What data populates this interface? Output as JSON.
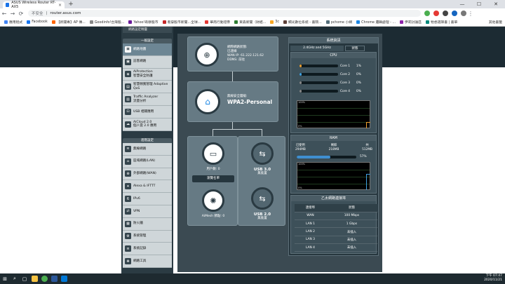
{
  "browser": {
    "tab_title": "ASUS Wireless Router RT-AX5",
    "tab_close": "×",
    "new_tab": "+",
    "win_min": "—",
    "win_max": "☐",
    "win_close": "✕",
    "security_label": "不安全",
    "url": "router.asus.com",
    "back": "←",
    "forward": "→",
    "reload": "⟳",
    "bookmarks": [
      "應用程式",
      "Facebook",
      "【新聞專】AP 傳...",
      "Goodinfo!台灣股...",
      "Yahoo!奇摩股市",
      "看穿股市新聞…全球...",
      "華南行動證券",
      "東森新聞（財經...",
      "3c",
      "嫻光數位系統 - 書院...",
      "pchome 小網",
      "Chrome 邏輯處理 - ...",
      "伊莉討論區",
      "牠想選擇書 | 書單"
    ],
    "other_bookmarks": "其他書籤"
  },
  "sidebar": {
    "top_item": "網路設定精靈",
    "general_header": "一般設定",
    "general": [
      {
        "label": "網路地圖",
        "icon": "▣"
      },
      {
        "label": "訪客網路",
        "icon": "▣"
      },
      {
        "label": "AiProtection\n智慧安全防護",
        "icon": "◈"
      },
      {
        "label": "智慧頻寬管理 Adaptive\nQoS",
        "icon": "▤"
      },
      {
        "label": "Traffic Analyzer\n流量分析",
        "icon": "▥"
      },
      {
        "label": "USB 相關應用",
        "icon": "⊡"
      },
      {
        "label": "AiCloud 2.0\n個人雲 2.0 應用",
        "icon": "☁"
      }
    ],
    "advanced_header": "進階設定",
    "advanced": [
      {
        "label": "無線網路",
        "icon": "≋"
      },
      {
        "label": "區域網路(LAN)",
        "icon": "⌂"
      },
      {
        "label": "外部網路(WAN)",
        "icon": "⊕"
      },
      {
        "label": "Alexa & IFTTT",
        "icon": "✦"
      },
      {
        "label": "IPv6",
        "icon": "6"
      },
      {
        "label": "VPN",
        "icon": "⇄"
      },
      {
        "label": "防火牆",
        "icon": "▦"
      },
      {
        "label": "系統管理",
        "icon": "⚙"
      },
      {
        "label": "系統記錄",
        "icon": "≡"
      },
      {
        "label": "網路工具",
        "icon": "✚"
      }
    ]
  },
  "map": {
    "internet": {
      "status_label": "網際網路狀態:",
      "status": "已連線",
      "wan_ip": "WAN IP: 61.222.121.62",
      "ddns": "DDNS: 前往"
    },
    "security": {
      "label": "無線安全層級:",
      "value": "WPA2-Personal"
    },
    "clients": {
      "label": "用戶數:",
      "count": "0",
      "button": "瀏覽名單"
    },
    "aimesh": {
      "label": "AiMesh 節點:",
      "count": "0"
    },
    "usb30": {
      "label": "USB 3.0",
      "status": "無裝置"
    },
    "usb20": {
      "label": "USB 2.0",
      "status": "無裝置"
    }
  },
  "status_panel": {
    "title": "系統資訊",
    "tab_band": "2.4GHz and 5GHz",
    "tab_status": "狀態",
    "cpu_title": "CPU",
    "cores": [
      {
        "label": "Core 1",
        "pct": "1%",
        "value": 1
      },
      {
        "label": "Core 2",
        "pct": "0%",
        "value": 0
      },
      {
        "label": "Core 3",
        "pct": "0%",
        "value": 0
      },
      {
        "label": "Core 4",
        "pct": "0%",
        "value": 0
      }
    ],
    "graph_top": "100%",
    "graph_bottom": "0%",
    "ram_title": "RAM",
    "ram": {
      "used_label": "已使用",
      "used": "294MB",
      "free_label": "剩餘",
      "free": "218MB",
      "total_label": "共",
      "total": "512MB",
      "pct": "57%",
      "value": 57
    },
    "eth_title": "乙太網路連接埠",
    "eth_headers": [
      "連接埠",
      "狀態"
    ],
    "eth_rows": [
      [
        "WAN",
        "100 Mbps"
      ],
      [
        "LAN 1",
        "1 Gbps"
      ],
      [
        "LAN 2",
        "未插入"
      ],
      [
        "LAN 3",
        "未插入"
      ],
      [
        "LAN 4",
        "未插入"
      ]
    ]
  },
  "taskbar": {
    "start": "⊞",
    "search": "⌕",
    "time": "下午 07:47",
    "date": "2020/11/21"
  },
  "colors": {
    "cpu_core1": "#f0a030",
    "cpu_core2": "#3fa0e0",
    "ram_bar": "#3f8fd0"
  }
}
